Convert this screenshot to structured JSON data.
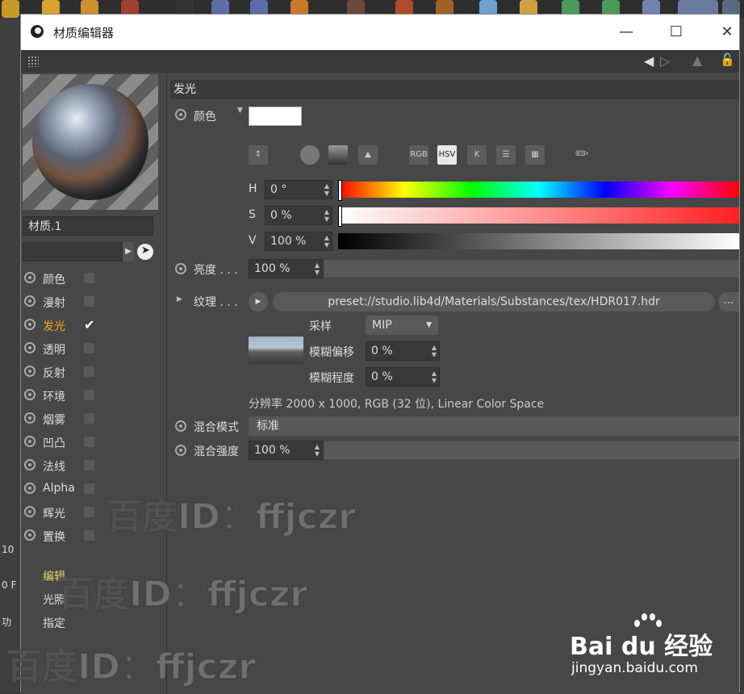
{
  "window": {
    "title": "材质编辑器"
  },
  "material": {
    "name": "材质.1"
  },
  "channels": [
    {
      "label": "颜色",
      "checked": false,
      "active": false
    },
    {
      "label": "漫射",
      "checked": false,
      "active": false
    },
    {
      "label": "发光",
      "checked": true,
      "active": true
    },
    {
      "label": "透明",
      "checked": false,
      "active": false
    },
    {
      "label": "反射",
      "checked": false,
      "active": false
    },
    {
      "label": "环境",
      "checked": false,
      "active": false
    },
    {
      "label": "烟雾",
      "checked": false,
      "active": false
    },
    {
      "label": "凹凸",
      "checked": false,
      "active": false
    },
    {
      "label": "法线",
      "checked": false,
      "active": false
    },
    {
      "label": "Alpha",
      "checked": false,
      "active": false
    },
    {
      "label": "辉光",
      "checked": false,
      "active": false
    },
    {
      "label": "置换",
      "checked": false,
      "active": false
    }
  ],
  "extra_items": [
    "编辑",
    "光照",
    "指定"
  ],
  "section": {
    "title": "发光"
  },
  "color": {
    "label": "颜色",
    "swatch": "#ffffff",
    "tools": [
      "RGB",
      "HSV",
      "K"
    ],
    "h_label": "H",
    "h_value": "0 °",
    "s_label": "S",
    "s_value": "0 %",
    "v_label": "V",
    "v_value": "100 %"
  },
  "brightness": {
    "label": "亮度 . . .",
    "value": "100 %"
  },
  "texture": {
    "label": "纹理 . . .",
    "path": "preset://studio.lib4d/Materials/Substances/tex/HDR017.hdr",
    "more": "...",
    "sampling_label": "采样",
    "sampling_value": "MIP",
    "blur_offset_label": "模糊偏移",
    "blur_offset_value": "0 %",
    "blur_scale_label": "模糊程度",
    "blur_scale_value": "0 %",
    "info": "分辨率 2000 x 1000, RGB (32 位), Linear Color Space"
  },
  "mix_mode": {
    "label": "混合模式",
    "value": "标准"
  },
  "mix_strength": {
    "label": "混合强度",
    "value": "100 %"
  },
  "left_edge_numbers": [
    "10",
    "0 F",
    "功"
  ],
  "watermarks": [
    "百度ID：ffjczr",
    "百度ID：ffjczr",
    "百度ID：ffjczr"
  ],
  "brand": {
    "logo_text": "Bai du 经验",
    "url": "jingyan.baidu.com"
  },
  "colors": {
    "accent": "#f5a623",
    "panel": "#474747",
    "field": "#393939"
  }
}
